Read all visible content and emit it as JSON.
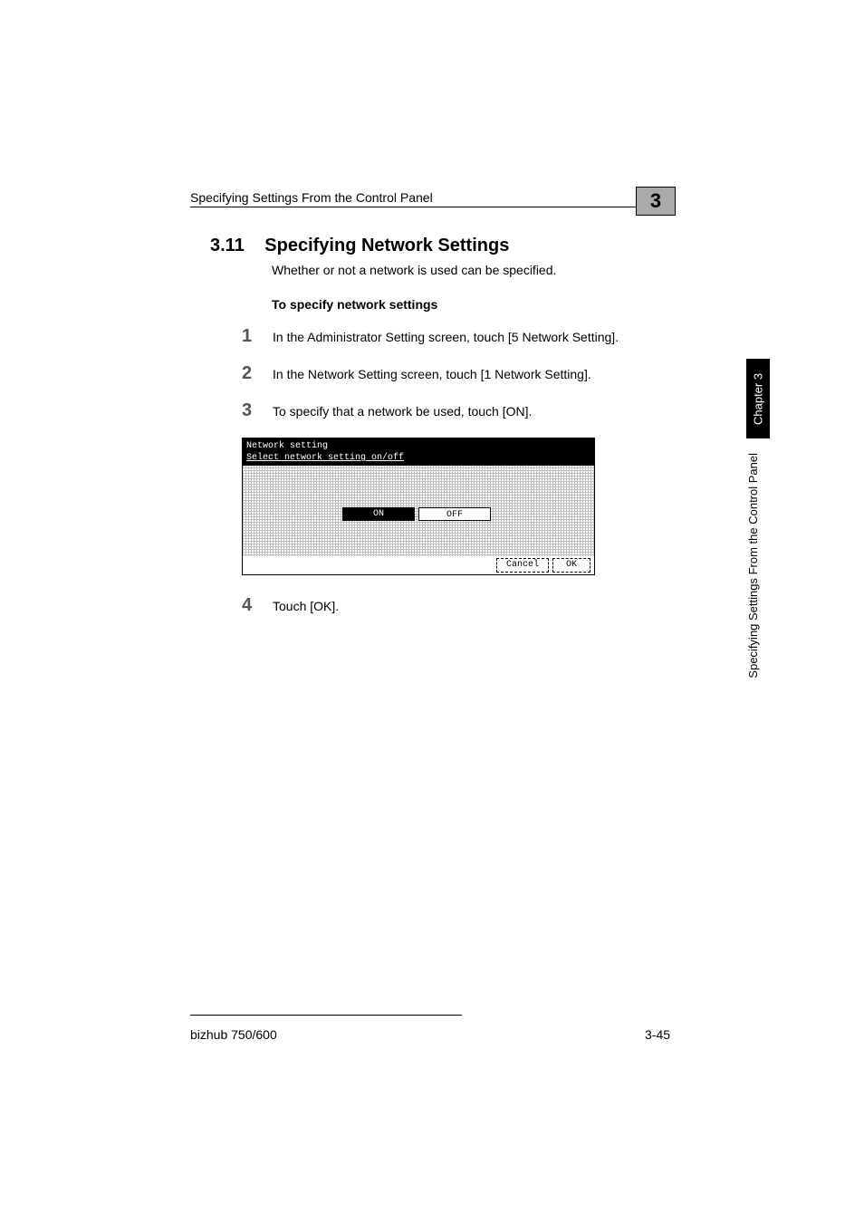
{
  "header": {
    "running_head": "Specifying Settings From the Control Panel",
    "chapter_number": "3"
  },
  "section": {
    "number": "3.11",
    "title": "Specifying Network Settings",
    "intro": "Whether or not a network is used can be specified.",
    "subhead": "To specify network settings"
  },
  "steps": [
    {
      "n": "1",
      "text": "In the Administrator Setting screen, touch [5 Network Setting]."
    },
    {
      "n": "2",
      "text": "In the Network Setting screen, touch [1 Network Setting]."
    },
    {
      "n": "3",
      "text": "To specify that a network be used, touch [ON]."
    },
    {
      "n": "4",
      "text": "Touch [OK]."
    }
  ],
  "screenshot": {
    "title": "Network setting",
    "subtitle": "Select network setting on/off",
    "on": "ON",
    "off": "OFF",
    "cancel": "Cancel",
    "ok": "OK"
  },
  "sidebar": {
    "chapter_tab": "Chapter 3",
    "side_label": "Specifying Settings From the Control Panel"
  },
  "footer": {
    "left": "bizhub 750/600",
    "right": "3-45"
  }
}
